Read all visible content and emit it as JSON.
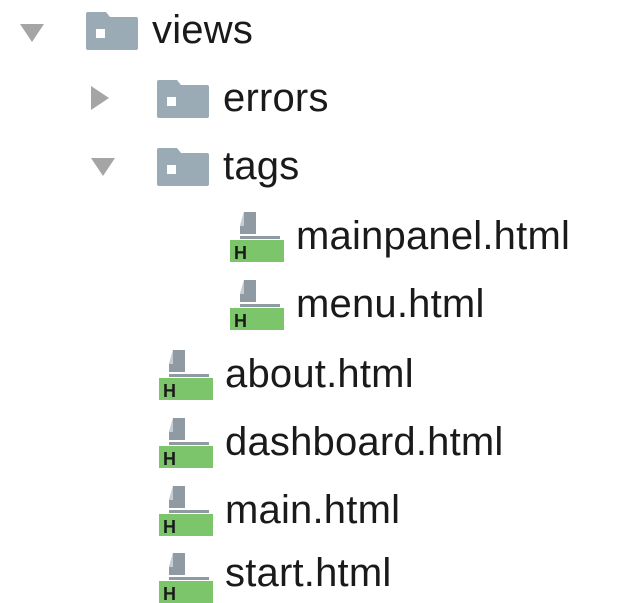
{
  "tree": {
    "root": {
      "name": "views",
      "expanded": true,
      "icon": "folder-icon",
      "children": {
        "errors": {
          "name": "errors",
          "expanded": false,
          "icon": "folder-icon"
        },
        "tags": {
          "name": "tags",
          "expanded": true,
          "icon": "folder-icon",
          "files": [
            "mainpanel.html",
            "menu.html"
          ]
        },
        "files": [
          "about.html",
          "dashboard.html",
          "main.html",
          "start.html"
        ]
      }
    },
    "file_icon_badge": "H",
    "colors": {
      "arrow": "#a5a5a5",
      "folder": "#9aabb6",
      "html_badge": "#7dc56a",
      "file_page": "#8f9aa2",
      "text": "#1a1a1a"
    }
  }
}
